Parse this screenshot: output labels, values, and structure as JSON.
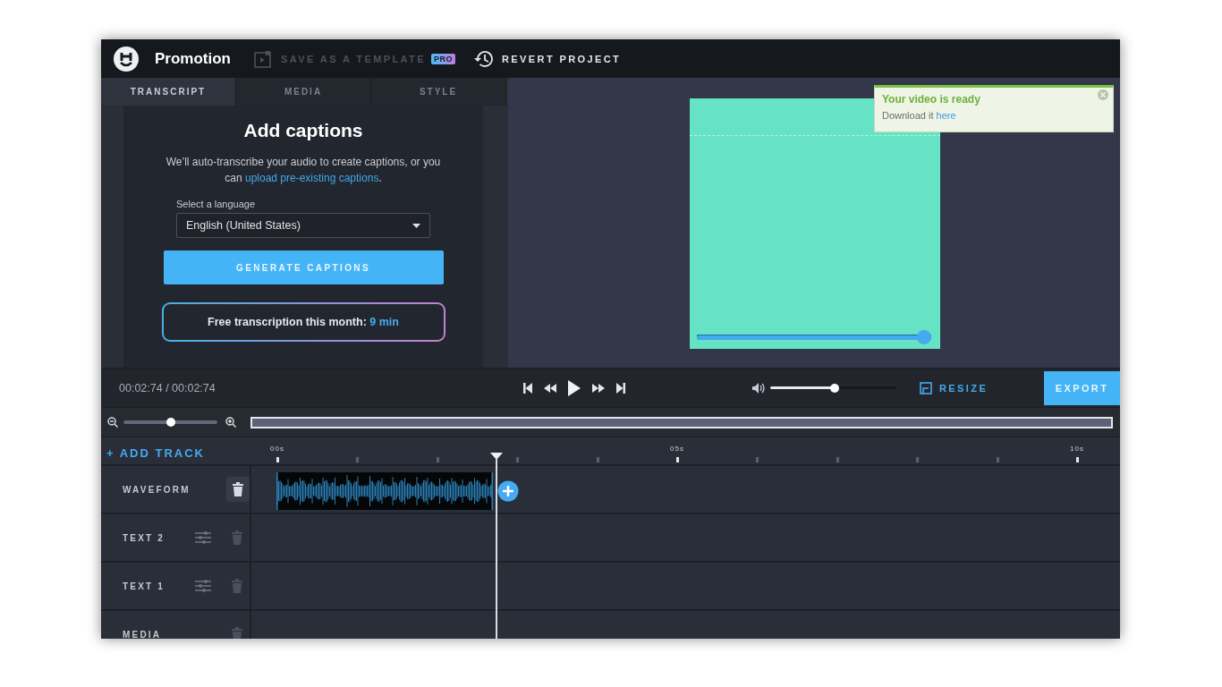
{
  "app": {
    "title": "Promotion"
  },
  "toolbar": [
    {
      "label": "SAVE AS A TEMPLATE",
      "badge": "PRO",
      "disabled": true
    },
    {
      "label": "REVERT PROJECT",
      "disabled": false
    }
  ],
  "tabs": [
    {
      "label": "TRANSCRIPT",
      "selected": true
    },
    {
      "label": "MEDIA",
      "selected": false
    },
    {
      "label": "STYLE",
      "selected": false
    }
  ],
  "captions": {
    "title": "Add captions",
    "text_before": "We’ll auto-transcribe your audio to create captions, or you can ",
    "link": "upload pre-existing captions",
    "text_after": ".",
    "language_label": "Select a language",
    "language_value": "English (United States)",
    "button": "GENERATE CAPTIONS",
    "quota_text": "Free transcription this month: ",
    "quota_value": "9 min"
  },
  "preview": {
    "progress": {
      "level": 0.97
    }
  },
  "notification": {
    "title": "Your video is ready",
    "text": "Download it ",
    "link": "here"
  },
  "playback": {
    "time": "00:02:74 / 00:02:74",
    "volume": {
      "level": 0.51
    },
    "resize": "RESIZE",
    "export": "EXPORT"
  },
  "zoom": {
    "level": 0.5
  },
  "timeline": {
    "add_track": "+ ADD TRACK",
    "ruler": [
      "00s",
      "05s",
      "10s"
    ],
    "tracks": [
      {
        "name": "WAVEFORM",
        "kind": "waveform"
      },
      {
        "name": "TEXT 2",
        "kind": "text"
      },
      {
        "name": "TEXT 1",
        "kind": "text"
      },
      {
        "name": "MEDIA",
        "kind": "media"
      }
    ]
  }
}
